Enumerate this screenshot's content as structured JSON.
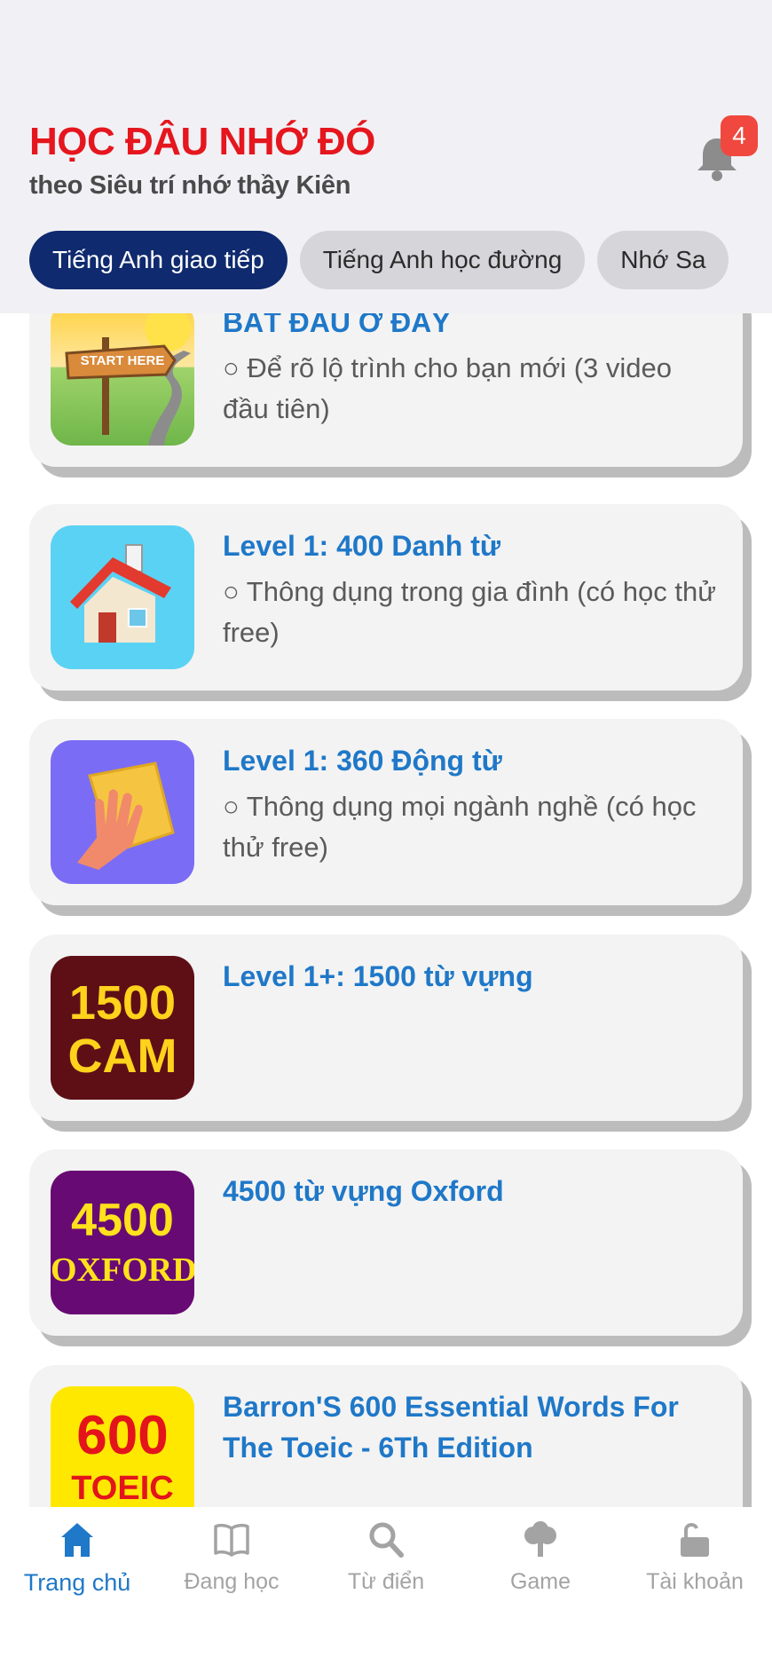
{
  "header": {
    "title": "HỌC ĐÂU NHỚ ĐÓ",
    "subtitle": "theo Siêu trí nhớ thầy Kiên",
    "notification_count": "4"
  },
  "tabs": [
    {
      "label": "Tiếng Anh giao tiếp",
      "active": true
    },
    {
      "label": "Tiếng Anh học đường",
      "active": false
    },
    {
      "label": "Nhớ Sa",
      "active": false
    }
  ],
  "courses": [
    {
      "title": "BẮT ĐẦU Ở ĐÂY",
      "description": "○ Để rõ lộ trình cho bạn mới (3 video đầu tiên)",
      "thumb_text": "START HERE"
    },
    {
      "title": "Level 1: 400 Danh từ",
      "description": "○ Thông dụng trong gia đình (có học thử free)",
      "thumb_icon": "house-icon"
    },
    {
      "title": "Level 1: 360 Động từ",
      "description": "○ Thông dụng mọi ngành nghề (có học thử free)",
      "thumb_icon": "hand-cloth-icon"
    },
    {
      "title": "Level 1+: 1500 từ vựng",
      "description": "",
      "thumb_line1": "1500",
      "thumb_line2": "CAM"
    },
    {
      "title": "4500 từ vựng Oxford",
      "description": "",
      "thumb_line1": "4500",
      "thumb_line2": "OXFORD"
    },
    {
      "title": "Barron'S 600 Essential Words For The Toeic - 6Th Edition",
      "description": "",
      "thumb_line1": "600",
      "thumb_line2": "TOEIC"
    }
  ],
  "bottom_nav": [
    {
      "label": "Trang chủ",
      "icon": "home-icon",
      "active": true
    },
    {
      "label": "Đang học",
      "icon": "book-icon",
      "active": false
    },
    {
      "label": "Từ điển",
      "icon": "search-icon",
      "active": false
    },
    {
      "label": "Game",
      "icon": "tree-icon",
      "active": false
    },
    {
      "label": "Tài khoản",
      "icon": "unlock-icon",
      "active": false
    }
  ],
  "colors": {
    "brand_red": "#e5161e",
    "accent_blue": "#1f78c8",
    "tab_active": "#0f2a6e"
  }
}
